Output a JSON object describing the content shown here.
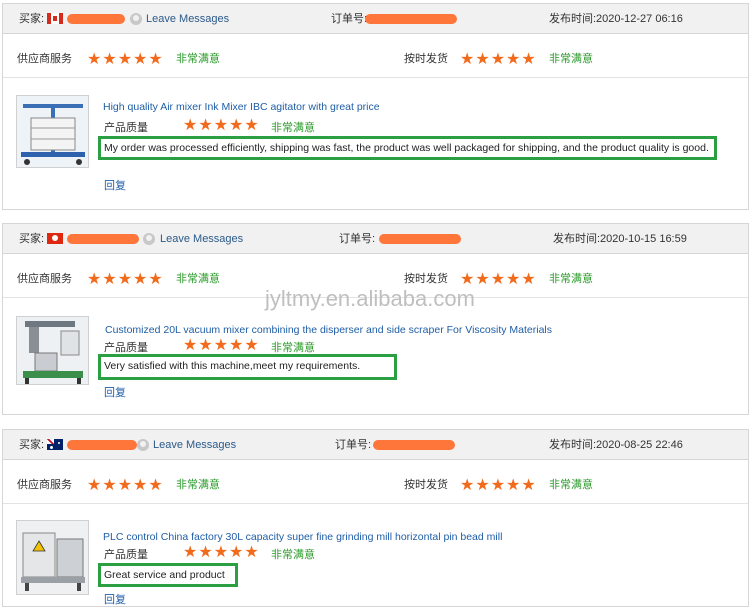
{
  "labels": {
    "buyer": "买家:",
    "order": "订单号:",
    "published": "发布时间:",
    "leave_messages": "Leave Messages",
    "supplier_service": "供应商服务",
    "on_time_delivery": "按时发货",
    "product_quality": "产品质量",
    "very_satisfied": "非常满意",
    "reply": "回复",
    "stars": "★★★★★"
  },
  "watermark": "jyltmy.en.alibaba.com",
  "reviews": [
    {
      "country": "Canada",
      "date": "2020-12-27 06:16",
      "rating_supplier": 5,
      "rating_delivery": 5,
      "rating_quality": 5,
      "product_title": "High quality Air mixer Ink Mixer IBC agitator with great price",
      "review_text": "My order was processed efficiently, shipping was fast, the product was well packaged for shipping, and the product quality is good."
    },
    {
      "country": "Hong Kong",
      "date": "2020-10-15 16:59",
      "rating_supplier": 5,
      "rating_delivery": 5,
      "rating_quality": 5,
      "product_title": "Customized 20L vacuum mixer combining the disperser and side scraper For Viscosity Materials",
      "review_text": "Very satisfied with this machine,meet my requirements."
    },
    {
      "country": "Australia",
      "date": "2020-08-25 22:46",
      "rating_supplier": 5,
      "rating_delivery": 5,
      "rating_quality": 5,
      "product_title": "PLC control China factory 30L capacity super fine grinding mill horizontal pin bead mill",
      "review_text": "Great service and product"
    }
  ],
  "colors": {
    "stars": "#f26b1d",
    "satisfied": "#2a9a2a",
    "link": "#1f5ea6",
    "highlight_box": "#2aa043",
    "redaction": "#fe6f2f"
  }
}
